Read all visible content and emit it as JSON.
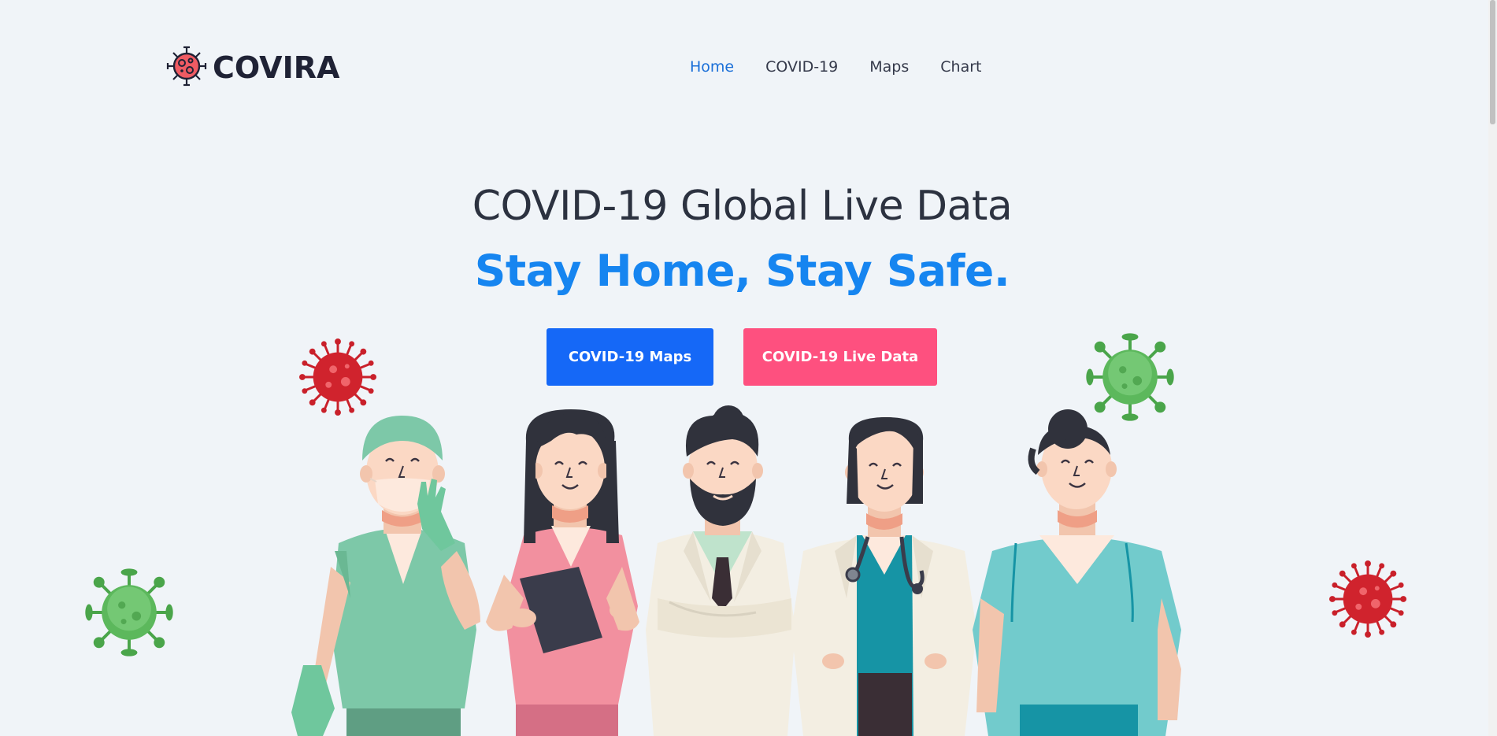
{
  "brand": {
    "name": "COVIRA",
    "icon": "virus-logo-icon"
  },
  "nav": {
    "items": [
      {
        "label": "Home",
        "active": true
      },
      {
        "label": "COVID-19",
        "active": false
      },
      {
        "label": "Maps",
        "active": false
      },
      {
        "label": "Chart",
        "active": false
      }
    ]
  },
  "hero": {
    "title": "COVID-19 Global Live Data",
    "subtitle": "Stay Home, Stay Safe."
  },
  "buttons": {
    "maps_label": "COVID-19 Maps",
    "live_label": "COVID-19 Live Data"
  },
  "colors": {
    "background": "#f0f4f8",
    "accent_blue": "#1685f0",
    "button_blue": "#1568f7",
    "button_pink": "#fe507f",
    "virus_red": "#d32d2d",
    "virus_green": "#5cb85c"
  }
}
